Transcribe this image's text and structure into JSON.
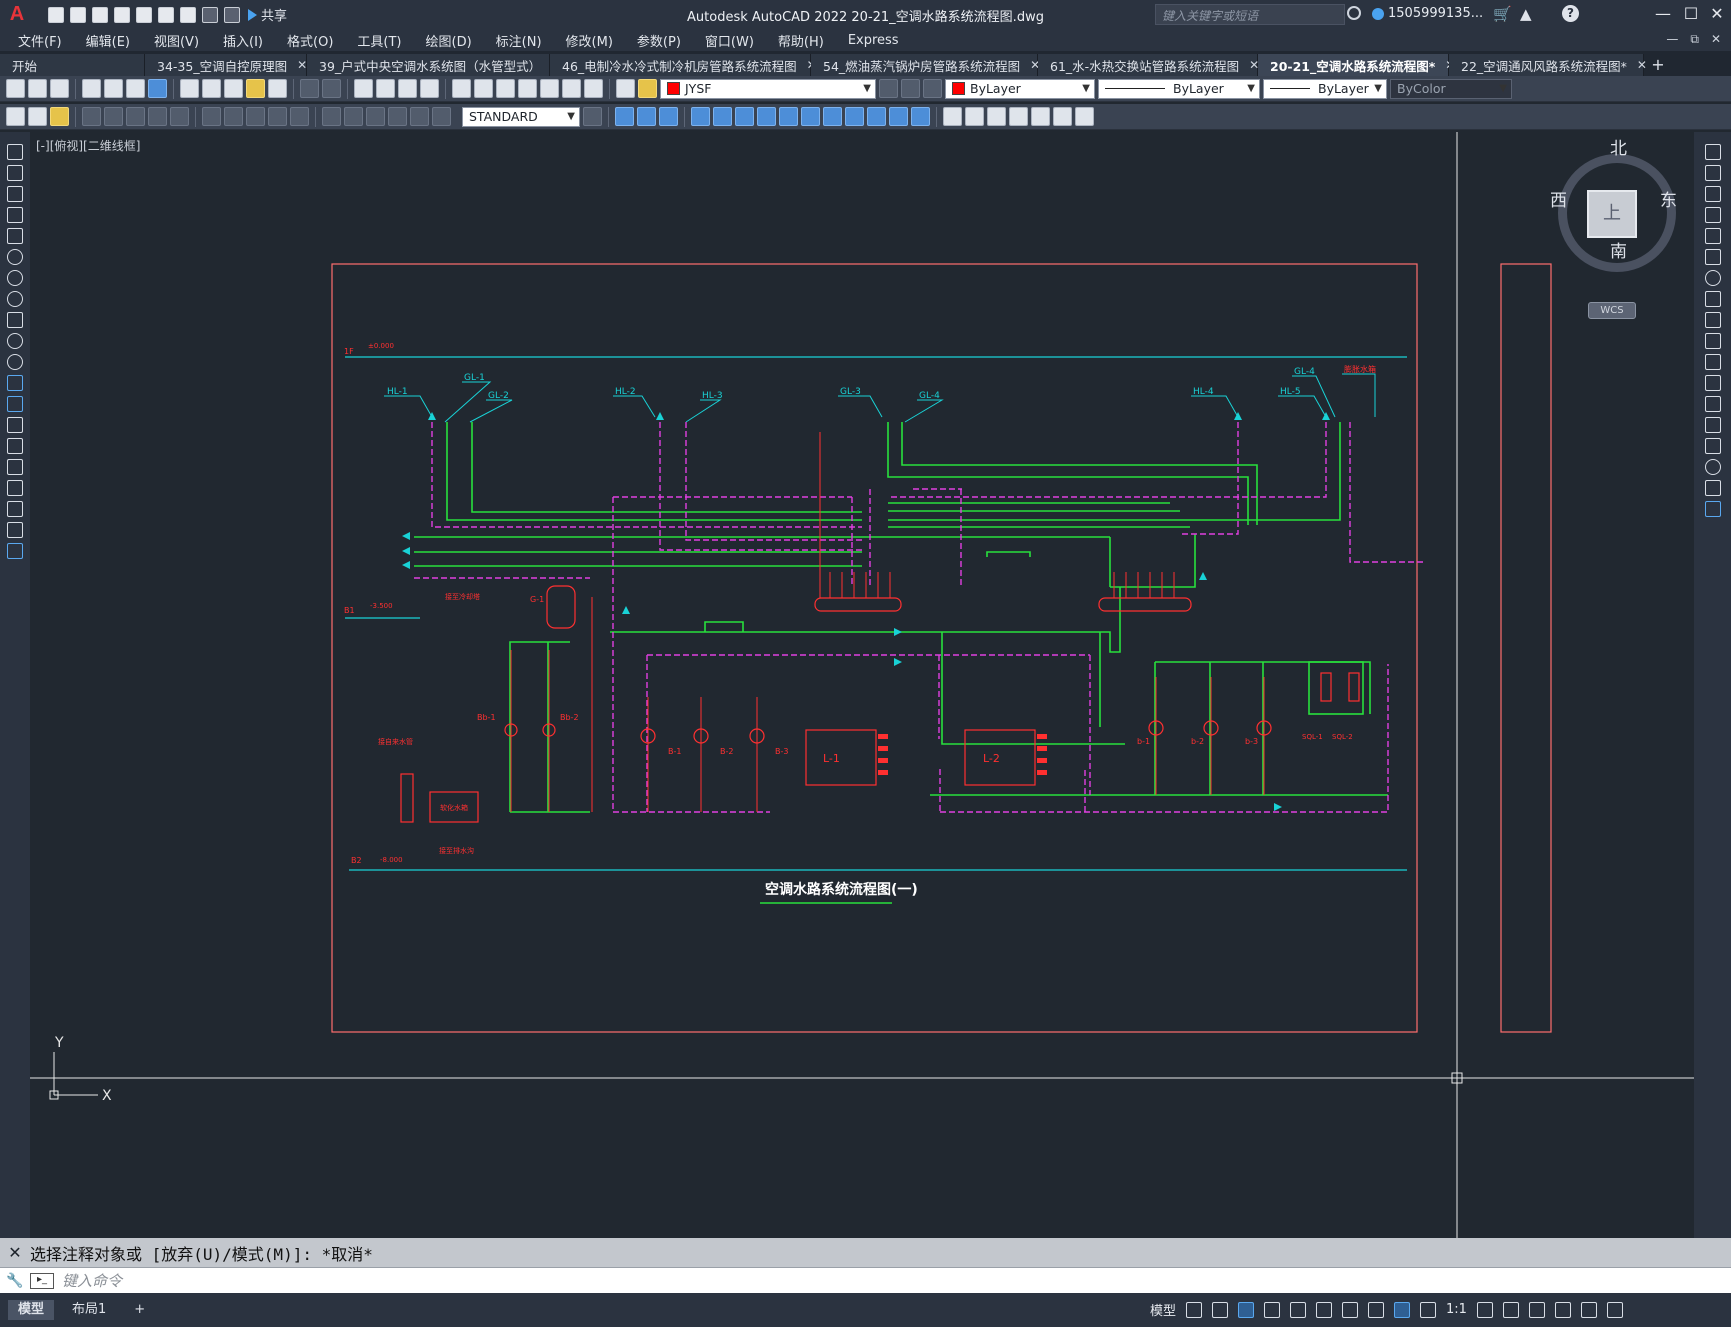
{
  "app": {
    "logo": "A",
    "title": "Autodesk AutoCAD 2022    20-21_空调水路系统流程图.dwg",
    "share_label": "共享",
    "search_placeholder": "键入关键字或短语",
    "user": "1505999135...",
    "window_controls": [
      "—",
      "☐",
      "✕"
    ]
  },
  "menu": {
    "items": [
      "文件(F)",
      "编辑(E)",
      "视图(V)",
      "插入(I)",
      "格式(O)",
      "工具(T)",
      "绘图(D)",
      "标注(N)",
      "修改(M)",
      "参数(P)",
      "窗口(W)",
      "帮助(H)",
      "Express"
    ],
    "right_controls": [
      "—",
      "⧉",
      "✕"
    ]
  },
  "tabs": [
    {
      "label": "开始",
      "active": false
    },
    {
      "label": "34-35_空调自控原理图",
      "active": false
    },
    {
      "label": "39_户式中央空调水系统图（水管型式）",
      "active": false
    },
    {
      "label": "46_电制冷水冷式制冷机房管路系统流程图",
      "active": false
    },
    {
      "label": "54_燃油蒸汽锅炉房管路系统流程图",
      "active": false
    },
    {
      "label": "61_水-水热交换站管路系统流程图",
      "active": false
    },
    {
      "label": "20-21_空调水路系统流程图*",
      "active": true
    },
    {
      "label": "22_空调通风风路系统流程图*",
      "active": false
    }
  ],
  "toolbar": {
    "layer_name": "JYSF",
    "color": "ByLayer",
    "linetype": "ByLayer",
    "lineweight": "ByLayer",
    "plotstyle": "ByColor",
    "textstyle": "STANDARD"
  },
  "viewport": {
    "label": "[-][俯视][二维线框]",
    "viewcube": {
      "top": "上",
      "north": "北",
      "south": "南",
      "east": "东",
      "west": "西",
      "wcs": "WCS"
    }
  },
  "drawing": {
    "title": "空调水路系统流程图(一)",
    "level_1f": "1F",
    "level_1f_elev": "±0.000",
    "level_b1": "B1",
    "level_b1_elev": "-3.500",
    "level_b2": "B2",
    "level_b2_elev": "-8.000",
    "risers": [
      "HL-1",
      "GL-1",
      "GL-2",
      "HL-2",
      "HL-3",
      "GL-3",
      "GL-4",
      "HL-4",
      "HL-5",
      "GL-4"
    ],
    "riser_right": "膨胀水箱",
    "equipment": {
      "chiller1": "L-1",
      "chiller2": "L-2",
      "tank": "G-1",
      "pumps_left": [
        "Bb-1",
        "Bb-2"
      ],
      "pumps_chw": [
        "B-1",
        "B-2",
        "B-3"
      ],
      "pumps_cw": [
        "b-1",
        "b-2",
        "b-3"
      ],
      "softener": [
        "SQL-1",
        "SQL-2"
      ],
      "note_makeup": "接至冷却塔",
      "note_water": "接自来水管",
      "note_treat": "软化水箱",
      "note_drain": "接至排水沟"
    }
  },
  "command": {
    "history": "选择注释对象或 [放弃(U)/模式(M)]: *取消*",
    "placeholder": "键入命令"
  },
  "status": {
    "layouts": [
      "模型",
      "布局1"
    ],
    "model_label": "模型",
    "scale": "1:1"
  }
}
